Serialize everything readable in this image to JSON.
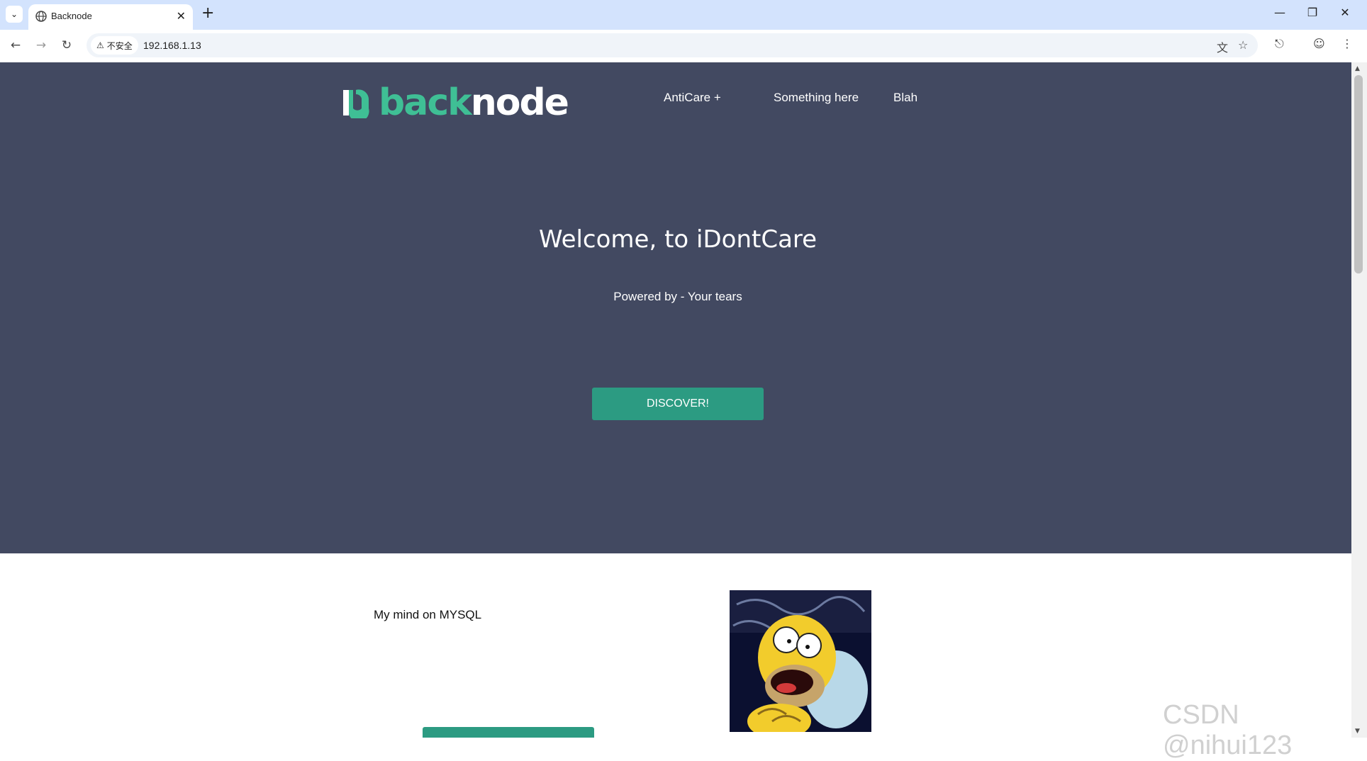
{
  "browser": {
    "tab_title": "Backnode",
    "security_label": "不安全",
    "url": "192.168.1.13"
  },
  "site": {
    "logo_part1": "back",
    "logo_part2": "node",
    "nav": [
      "AntiCare +",
      "Something here",
      "Blah"
    ]
  },
  "hero": {
    "title": "Welcome, to iDontCare",
    "subtitle": "Powered by - Your tears",
    "cta_label": "DISCOVER!"
  },
  "section": {
    "text": "My mind on MYSQL"
  },
  "watermark": "CSDN @nihui123",
  "colors": {
    "hero_bg": "#424961",
    "accent": "#2c9b82",
    "logo_green": "#3fbf95",
    "tabbar": "#d3e3fd"
  },
  "icons": {
    "tab_search": "chevron-down-icon",
    "globe": "globe-icon",
    "back": "arrow-left-icon",
    "forward": "arrow-right-icon",
    "reload": "reload-icon",
    "translate": "translate-icon",
    "bookmark": "star-icon",
    "extensions": "puzzle-icon",
    "profile": "profile-icon",
    "menu": "kebab-menu-icon"
  }
}
